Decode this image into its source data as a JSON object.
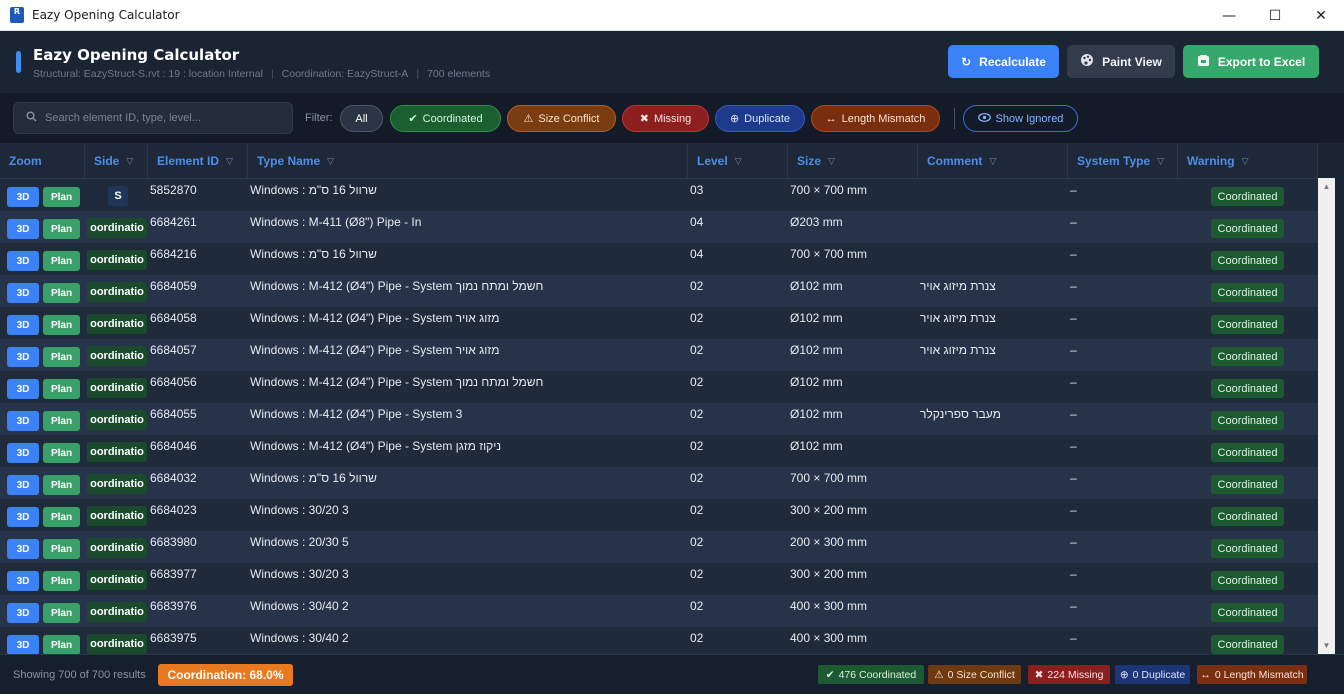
{
  "window": {
    "title": "Eazy Opening Calculator",
    "icon_letter": "R",
    "min": "—",
    "max": "☐",
    "close": "✕"
  },
  "header": {
    "title": "Eazy Opening Calculator",
    "structural": "Structural: EazyStruct-S.rvt : 19 : location Internal",
    "coordination": "Coordination: EazyStruct-A",
    "elements": "700 elements",
    "buttons": {
      "recalculate": "Recalculate",
      "paint": "Paint View",
      "export": "Export to Excel"
    }
  },
  "filterbar": {
    "search_placeholder": "Search element ID, type, level...",
    "label": "Filter:",
    "chips": {
      "all": "All",
      "coordinated": "Coordinated",
      "size_conflict": "Size Conflict",
      "missing": "Missing",
      "duplicate": "Duplicate",
      "length_mismatch": "Length Mismatch",
      "show_ignored": "Show Ignored"
    }
  },
  "table": {
    "columns": {
      "zoom": "Zoom",
      "side": "Side",
      "element_id": "Element ID",
      "type_name": "Type Name",
      "level": "Level",
      "size": "Size",
      "comment": "Comment",
      "system_type": "System Type",
      "warning": "Warning"
    },
    "zoom_3d": "3D",
    "zoom_plan": "Plan",
    "rows": [
      {
        "side": "S",
        "id": "5852870",
        "type": "Windows : שרוול 16 ס\"מ",
        "level": "03",
        "size": "700 × 700 mm",
        "comment": "",
        "system": "–",
        "warning": "Coordinated"
      },
      {
        "side": "oordinatio",
        "id": "6684261",
        "type": "Windows : M-411 (Ø8\") Pipe - In",
        "level": "04",
        "size": "Ø203 mm",
        "comment": "",
        "system": "–",
        "warning": "Coordinated"
      },
      {
        "side": "oordinatio",
        "id": "6684216",
        "type": "Windows : שרוול 16 ס\"מ",
        "level": "04",
        "size": "700 × 700 mm",
        "comment": "",
        "system": "–",
        "warning": "Coordinated"
      },
      {
        "side": "oordinatio",
        "id": "6684059",
        "type": "Windows : M-412 (Ø4\") Pipe - System חשמל ומתח נמוך",
        "level": "02",
        "size": "Ø102 mm",
        "comment": "צנרת מיזוג אויר",
        "system": "–",
        "warning": "Coordinated"
      },
      {
        "side": "oordinatio",
        "id": "6684058",
        "type": "Windows : M-412 (Ø4\") Pipe - System מזוג אויר",
        "level": "02",
        "size": "Ø102 mm",
        "comment": "צנרת מיזוג אויר",
        "system": "–",
        "warning": "Coordinated"
      },
      {
        "side": "oordinatio",
        "id": "6684057",
        "type": "Windows : M-412 (Ø4\") Pipe - System מזוג אויר",
        "level": "02",
        "size": "Ø102 mm",
        "comment": "צנרת מיזוג אויר",
        "system": "–",
        "warning": "Coordinated"
      },
      {
        "side": "oordinatio",
        "id": "6684056",
        "type": "Windows : M-412 (Ø4\") Pipe - System חשמל ומתח נמוך",
        "level": "02",
        "size": "Ø102 mm",
        "comment": "",
        "system": "–",
        "warning": "Coordinated"
      },
      {
        "side": "oordinatio",
        "id": "6684055",
        "type": "Windows : M-412 (Ø4\") Pipe - System 3",
        "level": "02",
        "size": "Ø102 mm",
        "comment": "מעבר ספרינקלר",
        "system": "–",
        "warning": "Coordinated"
      },
      {
        "side": "oordinatio",
        "id": "6684046",
        "type": "Windows : M-412 (Ø4\") Pipe - System ניקוז מזגן",
        "level": "02",
        "size": "Ø102 mm",
        "comment": "",
        "system": "–",
        "warning": "Coordinated"
      },
      {
        "side": "oordinatio",
        "id": "6684032",
        "type": "Windows : שרוול 16 ס\"מ",
        "level": "02",
        "size": "700 × 700 mm",
        "comment": "",
        "system": "–",
        "warning": "Coordinated"
      },
      {
        "side": "oordinatio",
        "id": "6684023",
        "type": "Windows : 30/20 3",
        "level": "02",
        "size": "300 × 200 mm",
        "comment": "",
        "system": "–",
        "warning": "Coordinated"
      },
      {
        "side": "oordinatio",
        "id": "6683980",
        "type": "Windows : 20/30 5",
        "level": "02",
        "size": "200 × 300 mm",
        "comment": "",
        "system": "–",
        "warning": "Coordinated"
      },
      {
        "side": "oordinatio",
        "id": "6683977",
        "type": "Windows : 30/20 3",
        "level": "02",
        "size": "300 × 200 mm",
        "comment": "",
        "system": "–",
        "warning": "Coordinated"
      },
      {
        "side": "oordinatio",
        "id": "6683976",
        "type": "Windows : 30/40 2",
        "level": "02",
        "size": "400 × 300 mm",
        "comment": "",
        "system": "–",
        "warning": "Coordinated"
      },
      {
        "side": "oordinatio",
        "id": "6683975",
        "type": "Windows : 30/40 2",
        "level": "02",
        "size": "400 × 300 mm",
        "comment": "",
        "system": "–",
        "warning": "Coordinated"
      }
    ]
  },
  "footer": {
    "showing": "Showing 700 of 700 results",
    "coordination": "Coordination: 68.0%",
    "badges": {
      "coordinated": "476 Coordinated",
      "size_conflict": "0 Size Conflict",
      "missing": "224 Missing",
      "duplicate": "0 Duplicate",
      "length_mismatch": "0 Length Mismatch"
    }
  },
  "colors": {
    "accent": "#3b82f6",
    "coordinated": "#1e5a31",
    "size_conflict": "#7a3d12",
    "missing": "#8e1f1f",
    "duplicate": "#1e3a8a",
    "length_mismatch": "#7a2e10",
    "coordination_pct": "#e8791f"
  },
  "icons": {
    "recalculate": "refresh-icon",
    "paint": "palette-icon",
    "export": "excel-icon",
    "search": "search-icon",
    "check": "check-icon",
    "warning": "warning-icon",
    "missing": "x-icon",
    "duplicate": "duplicate-icon",
    "length": "arrows-icon",
    "ignored": "eye-icon"
  }
}
